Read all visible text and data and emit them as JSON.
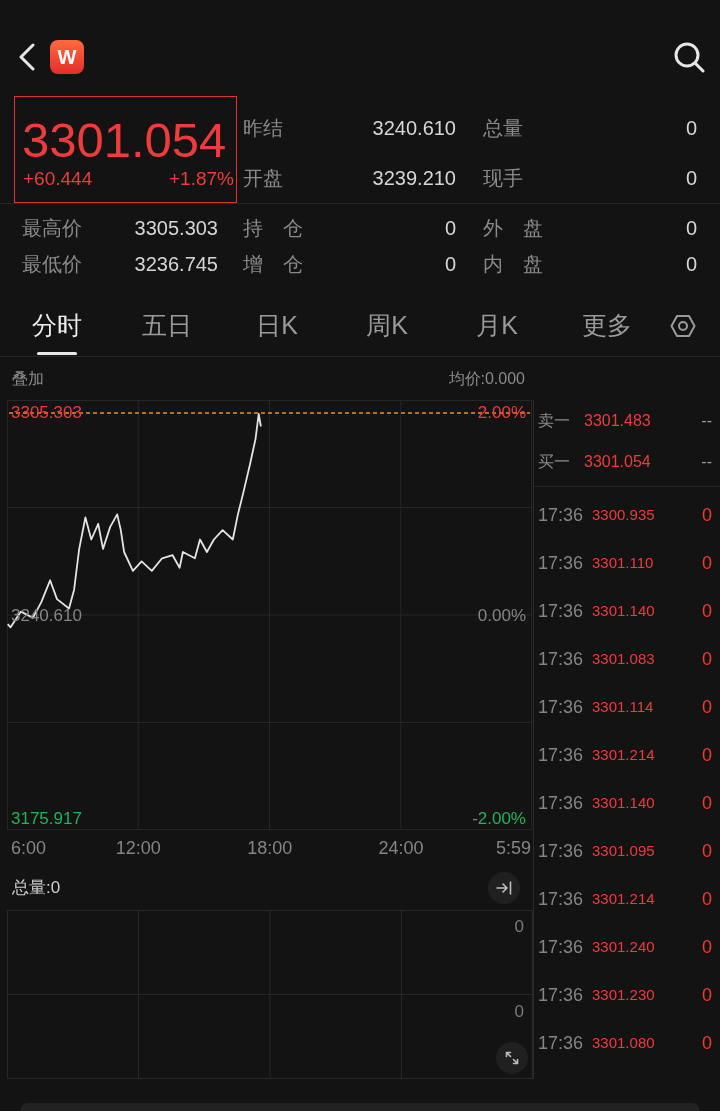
{
  "logo": {
    "letter": "W"
  },
  "quote": {
    "price": "3301.054",
    "change": "+60.444",
    "change_pct": "+1.87%",
    "top_rows": [
      [
        {
          "label": "昨结",
          "value": "3240.610"
        },
        {
          "label": "总量",
          "value": "0"
        }
      ],
      [
        {
          "label": "开盘",
          "value": "3239.210"
        },
        {
          "label": "现手",
          "value": "0"
        }
      ]
    ],
    "bottom_rows": [
      [
        {
          "label": "最高价",
          "value": "3305.303"
        },
        {
          "label": "持　仓",
          "value": "0"
        },
        {
          "label": "外　盘",
          "value": "0"
        }
      ],
      [
        {
          "label": "最低价",
          "value": "3236.745"
        },
        {
          "label": "增　仓",
          "value": "0"
        },
        {
          "label": "内　盘",
          "value": "0"
        }
      ]
    ]
  },
  "tabs": [
    {
      "label": "分时",
      "selected": true
    },
    {
      "label": "五日",
      "selected": false
    },
    {
      "label": "日K",
      "selected": false
    },
    {
      "label": "周K",
      "selected": false
    },
    {
      "label": "月K",
      "selected": false
    },
    {
      "label": "更多",
      "selected": false
    }
  ],
  "chart": {
    "overlay_label": "叠加",
    "avg_price": "均价:0.000",
    "percent_labels": [
      "2.00%",
      "0.00%",
      "-2.00%"
    ],
    "session_end_label": "5:59",
    "chart_data": {
      "type": "line",
      "x": [
        362,
        370,
        398,
        431,
        454,
        478,
        497,
        530,
        544,
        558,
        575,
        591,
        610,
        623,
        643,
        662,
        672,
        681,
        705,
        729,
        757,
        785,
        814,
        833,
        842,
        875,
        889,
        908,
        927,
        951,
        979,
        993,
        1008,
        1026,
        1041,
        1050,
        1056
      ],
      "values": [
        3238,
        3237,
        3242,
        3240,
        3245,
        3252,
        3246,
        3243,
        3249,
        3262,
        3272,
        3265,
        3270,
        3262,
        3269,
        3273,
        3268,
        3261,
        3255,
        3258,
        3255,
        3259,
        3260,
        3256,
        3261,
        3259,
        3265,
        3261,
        3265,
        3268,
        3265,
        3273,
        3280,
        3289,
        3297,
        3305,
        3301
      ],
      "xlim": [
        360,
        1799
      ],
      "ylim": [
        3172.41,
        3309.45
      ],
      "xticks": [
        {
          "value": 360,
          "label": "6:00"
        },
        {
          "value": 720,
          "label": "12:00"
        },
        {
          "value": 1080,
          "label": "18:00"
        },
        {
          "value": 1440,
          "label": "24:00"
        }
      ],
      "yticks": [
        {
          "value": 3175.917,
          "label": "3175.917"
        },
        {
          "value": 3240.61,
          "label": "3240.610"
        },
        {
          "value": 3305.303,
          "label": "3305.303"
        }
      ],
      "grid": true,
      "ref_lines": [
        {
          "axis": "y",
          "value": 3305.303
        }
      ]
    }
  },
  "volume": {
    "total": "总量:0",
    "axis_labels": [
      "0",
      "0"
    ]
  },
  "order_book": [
    {
      "label": "卖一",
      "price": "3301.483",
      "volume": "--"
    },
    {
      "label": "买一",
      "price": "3301.054",
      "volume": "--"
    }
  ],
  "trades": [
    {
      "time": "17:36",
      "price": "3300.935",
      "volume": "0"
    },
    {
      "time": "17:36",
      "price": "3301.110",
      "volume": "0"
    },
    {
      "time": "17:36",
      "price": "3301.140",
      "volume": "0"
    },
    {
      "time": "17:36",
      "price": "3301.083",
      "volume": "0"
    },
    {
      "time": "17:36",
      "price": "3301.114",
      "volume": "0"
    },
    {
      "time": "17:36",
      "price": "3301.214",
      "volume": "0"
    },
    {
      "time": "17:36",
      "price": "3301.140",
      "volume": "0"
    },
    {
      "time": "17:36",
      "price": "3301.095",
      "volume": "0"
    },
    {
      "time": "17:36",
      "price": "3301.214",
      "volume": "0"
    },
    {
      "time": "17:36",
      "price": "3301.240",
      "volume": "0"
    },
    {
      "time": "17:36",
      "price": "3301.230",
      "volume": "0"
    },
    {
      "time": "17:36",
      "price": "3301.080",
      "volume": "0"
    }
  ]
}
